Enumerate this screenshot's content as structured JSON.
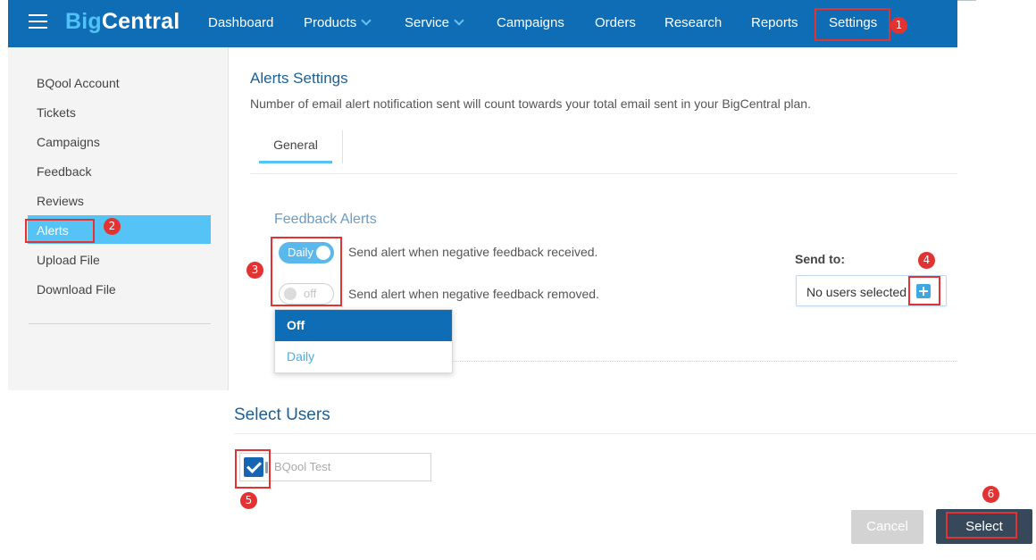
{
  "header": {
    "logo_big": "Big",
    "logo_central": "Central",
    "nav": [
      {
        "label": "Dashboard"
      },
      {
        "label": "Products"
      },
      {
        "label": "Service"
      },
      {
        "label": "Campaigns"
      },
      {
        "label": "Orders"
      },
      {
        "label": "Research"
      },
      {
        "label": "Reports"
      },
      {
        "label": "Settings"
      }
    ]
  },
  "sidebar": {
    "items": [
      {
        "label": "BQool Account"
      },
      {
        "label": "Tickets"
      },
      {
        "label": "Campaigns"
      },
      {
        "label": "Feedback"
      },
      {
        "label": "Reviews"
      },
      {
        "label": "Alerts"
      },
      {
        "label": "Upload File"
      },
      {
        "label": "Download File"
      }
    ]
  },
  "main": {
    "title": "Alerts Settings",
    "description": "Number of email alert notification sent will count towards your total email sent in your BigCentral plan.",
    "tabs": [
      {
        "label": "General"
      }
    ],
    "feedback": {
      "title": "Feedback Alerts",
      "alerts": [
        {
          "toggle": "Daily",
          "text": "Send alert when negative feedback received."
        },
        {
          "toggle": "off",
          "text": "Send alert when negative feedback removed."
        }
      ],
      "dropdown_options": [
        "Off",
        "Daily"
      ],
      "send_to_label": "Send to:",
      "send_to_value": "No users selected"
    }
  },
  "modal": {
    "title": "Select Users",
    "users": [
      {
        "name": "BQool Test",
        "checked": true
      }
    ],
    "cancel_label": "Cancel",
    "select_label": "Select"
  },
  "annotations": [
    "1",
    "2",
    "3",
    "4",
    "5",
    "6"
  ],
  "colors": {
    "nav_bg": "#0f6db5",
    "sidebar_active": "#55c3f5",
    "highlight": "#e23232",
    "select_button": "#37485a"
  }
}
